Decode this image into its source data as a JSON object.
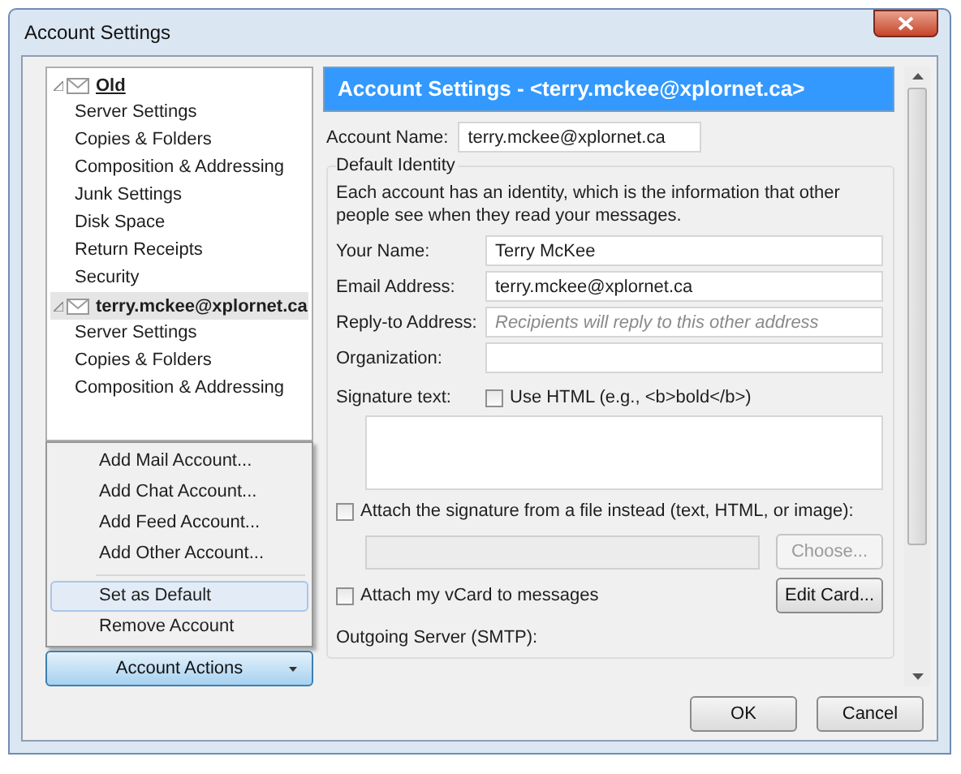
{
  "window": {
    "title": "Account Settings"
  },
  "tree": [
    {
      "label": "Old",
      "expanded": true,
      "selected": false,
      "children": [
        {
          "label": "Server Settings",
          "selected": false
        },
        {
          "label": "Copies & Folders",
          "selected": false
        },
        {
          "label": "Composition & Addressing",
          "selected": false
        },
        {
          "label": "Junk Settings",
          "selected": false
        },
        {
          "label": "Disk Space",
          "selected": false
        },
        {
          "label": "Return Receipts",
          "selected": false
        },
        {
          "label": "Security",
          "selected": false
        }
      ]
    },
    {
      "label": "terry.mckee@xplornet.ca",
      "expanded": true,
      "selected": true,
      "children": [
        {
          "label": "Server Settings",
          "selected": false
        },
        {
          "label": "Copies & Folders",
          "selected": false
        },
        {
          "label": "Composition & Addressing",
          "selected": false
        }
      ]
    }
  ],
  "menu": [
    {
      "kind": "item",
      "label": "Add Mail Account...",
      "selected": false
    },
    {
      "kind": "item",
      "label": "Add Chat Account...",
      "selected": false
    },
    {
      "kind": "item",
      "label": "Add Feed Account...",
      "selected": false
    },
    {
      "kind": "item",
      "label": "Add Other Account...",
      "selected": false
    },
    {
      "kind": "separator"
    },
    {
      "kind": "item",
      "label": "Set as Default",
      "selected": true
    },
    {
      "kind": "item",
      "label": "Remove Account",
      "selected": false
    }
  ],
  "account_actions": {
    "label": "Account Actions"
  },
  "panel": {
    "header": "Account Settings - <terry.mckee@xplornet.ca>",
    "account_name": {
      "label": "Account Name:",
      "value": "terry.mckee@xplornet.ca"
    },
    "identity": {
      "legend": "Default Identity",
      "description": "Each account has an identity, which is the information that other people see when they read your messages.",
      "fields": [
        {
          "label": "Your Name:",
          "value": "Terry McKee"
        },
        {
          "label": "Email Address:",
          "value": "terry.mckee@xplornet.ca"
        },
        {
          "label": "Reply-to Address:",
          "placeholder": "Recipients will reply to this other address"
        },
        {
          "label": "Organization:"
        }
      ],
      "signature_label": "Signature text:",
      "use_html": {
        "label": "Use HTML (e.g., <b>bold</b>)",
        "checked": false
      },
      "attach_file": {
        "label": "Attach the signature from a file instead (text, HTML, or image):",
        "checked": false
      },
      "choose_button": {
        "label": "Choose...",
        "disabled": true
      },
      "vcard": {
        "label": "Attach my vCard to messages",
        "checked": false
      },
      "edit_card_button": {
        "label": "Edit Card...",
        "disabled": false
      }
    },
    "outgoing_label": "Outgoing Server (SMTP):"
  },
  "buttons": [
    "OK",
    "Cancel"
  ]
}
